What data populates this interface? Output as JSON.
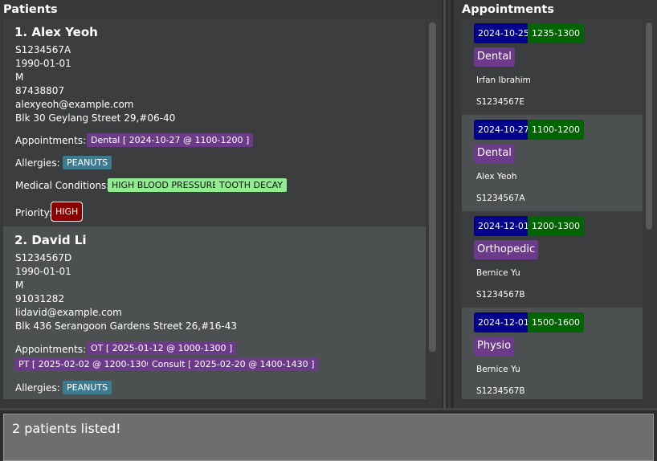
{
  "patients_panel": {
    "title": "Patients"
  },
  "appointments_panel": {
    "title": "Appointments"
  },
  "patients": [
    {
      "name": "1. Alex Yeoh",
      "nric": "S1234567A",
      "dob": "1990-01-01",
      "gender": "M",
      "phone": "87438807",
      "email": "alexyeoh@example.com",
      "address": "Blk 30 Geylang Street 29,#06-40",
      "appointments_label": "Appointments:",
      "appointments": [
        "Dental [ 2024-10-27 @ 1100-1200 ]"
      ],
      "allergies_label": "Allergies:",
      "allergies": [
        "PEANUTS"
      ],
      "conditions_label": "Medical Conditions:",
      "conditions": [
        "HIGH BLOOD PRESSURE",
        "TOOTH DECAY"
      ],
      "priority_label": "Priority:",
      "priority": "HIGH"
    },
    {
      "name": "2. David Li",
      "nric": "S1234567D",
      "dob": "1990-01-01",
      "gender": "M",
      "phone": "91031282",
      "email": "lidavid@example.com",
      "address": "Blk 436 Serangoon Gardens Street 26,#16-43",
      "appointments_label": "Appointments:",
      "appointments": [
        "OT [ 2025-01-12 @ 1000-1300 ]",
        "PT [ 2025-02-02 @ 1200-1300 ]",
        "Consult [ 2025-02-20 @ 1400-1430 ]"
      ],
      "allergies_label": "Allergies:",
      "allergies": [
        "PEANUTS"
      ]
    }
  ],
  "appointments": [
    {
      "date": "2024-10-25",
      "time": "1235-1300",
      "type": "Dental",
      "name": "Irfan Ibrahim",
      "nric": "S1234567E"
    },
    {
      "date": "2024-10-27",
      "time": "1100-1200",
      "type": "Dental",
      "name": "Alex Yeoh",
      "nric": "S1234567A"
    },
    {
      "date": "2024-12-01",
      "time": "1200-1300",
      "type": "Orthopedic",
      "name": "Bernice Yu",
      "nric": "S1234567B"
    },
    {
      "date": "2024-12-01",
      "time": "1500-1600",
      "type": "Physio",
      "name": "Bernice Yu",
      "nric": "S1234567B"
    }
  ],
  "result": {
    "text": "2 patients listed!"
  },
  "colors": {
    "appointment_tag": "#6b3b8a",
    "allergy_tag": "#3e7b91",
    "condition_tag": "#90ee90",
    "priority_high": "#8b0000",
    "date_badge": "#00008b",
    "time_badge": "#006400"
  }
}
